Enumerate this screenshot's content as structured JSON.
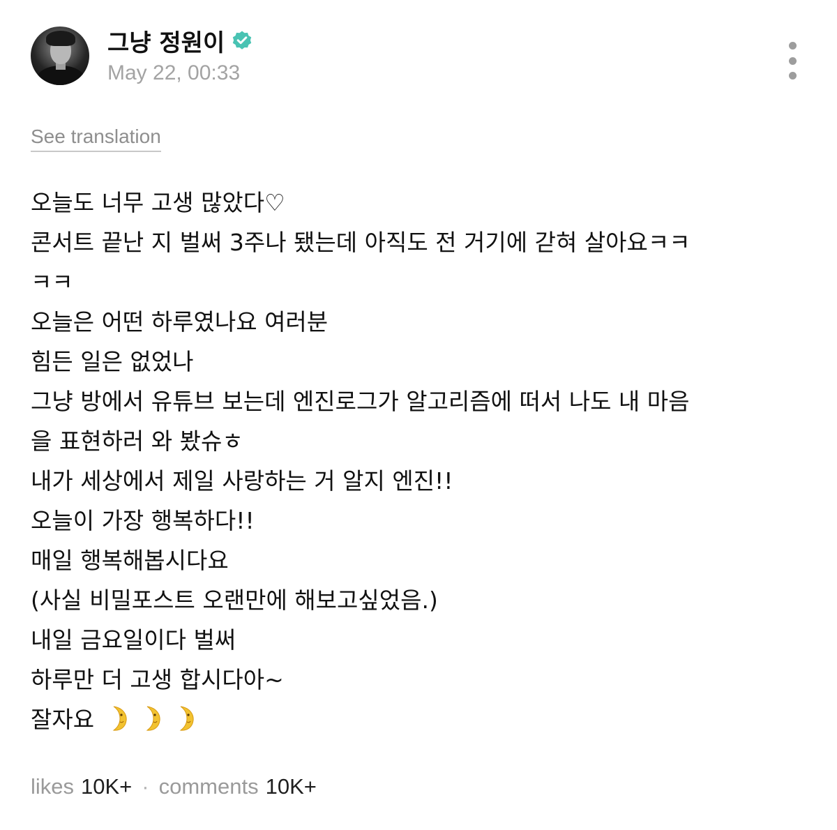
{
  "post": {
    "author": {
      "name": "그냥 정원이",
      "verified": true,
      "avatar_icon": "profile-photo-avatar"
    },
    "timestamp": "May 22, 00:33",
    "more_icon": "vertical-ellipsis-icon",
    "see_translation_label": "See translation",
    "body_lines": [
      "오늘도 너무 고생 많았다♡",
      "콘서트 끝난 지 벌써 3주나 됐는데 아직도 전 거기에 갇혀 살아요ㅋㅋ",
      "ㅋㅋ",
      "오늘은 어떤 하루였나요 여러분",
      "힘든 일은 없었나",
      "그냥 방에서 유튜브 보는데 엔진로그가 알고리즘에 떠서 나도 내 마음",
      "을 표현하러 와 봤슈ㅎ",
      "내가 세상에서 제일 사랑하는 거 알지 엔진!!",
      "오늘이 가장 행복하다!!",
      "매일 행복해봅시다요",
      "(사실 비밀포스트 오랜만에 해보고싶었음.)",
      "내일 금요일이다 벌써",
      "하루만 더 고생 합시다아~",
      "잘자요"
    ],
    "closing_emoji": [
      "moon-face-icon",
      "moon-face-icon",
      "moon-face-icon"
    ],
    "stats": {
      "likes_label": "likes",
      "likes_count": "10K+",
      "separator": "·",
      "comments_label": "comments",
      "comments_count": "10K+"
    },
    "colors": {
      "verified_badge": "#49c3b3",
      "muted_text": "#a3a3a3",
      "moon": "#f2c230"
    }
  }
}
